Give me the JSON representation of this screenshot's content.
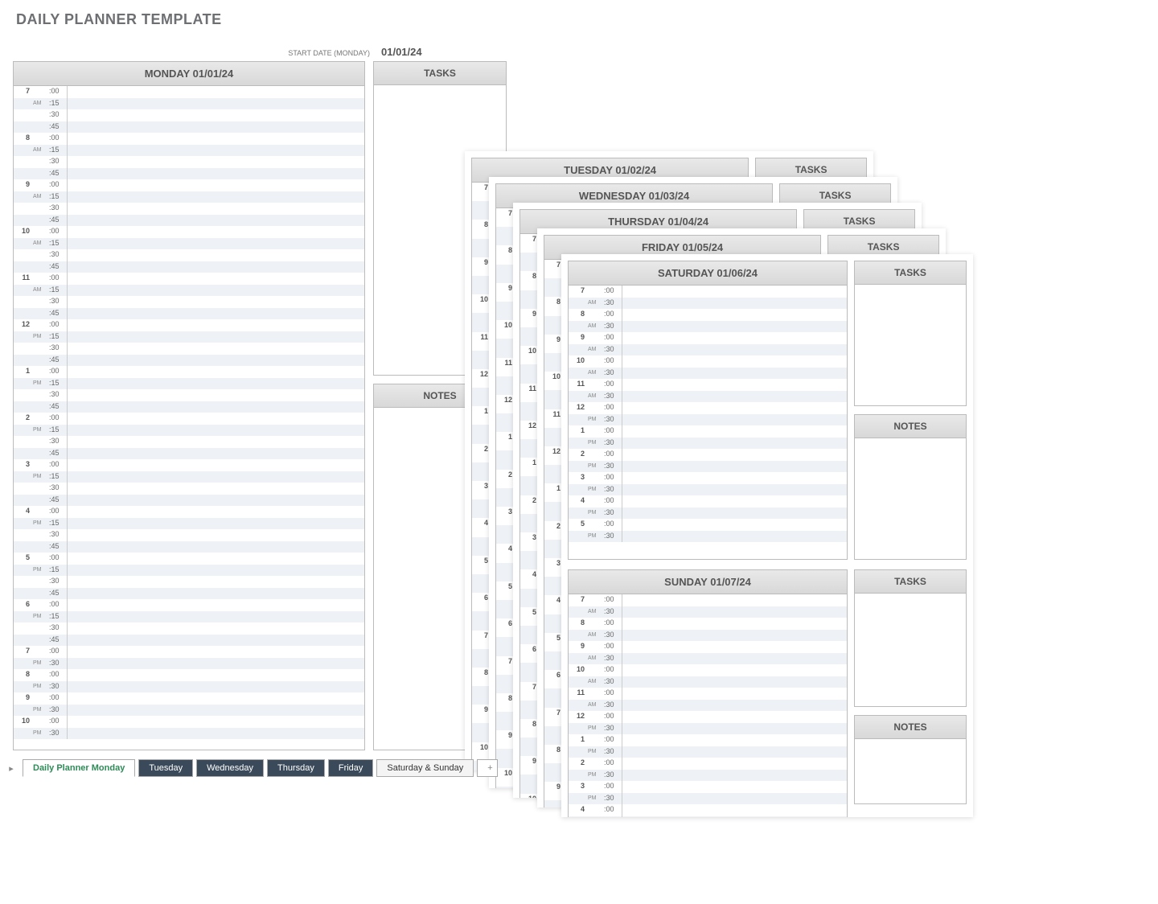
{
  "title": "DAILY PLANNER TEMPLATE",
  "start_date_label": "START DATE (MONDAY)",
  "start_date_value": "01/01/24",
  "tasks_label": "TASKS",
  "notes_label": "NOTES",
  "days": {
    "monday": "MONDAY 01/01/24",
    "tuesday": "TUESDAY 01/02/24",
    "wednesday": "WEDNESDAY 01/03/24",
    "thursday": "THURSDAY 01/04/24",
    "friday": "FRIDAY 01/05/24",
    "saturday": "SATURDAY 01/06/24",
    "sunday": "SUNDAY 01/07/24"
  },
  "monday_schedule": [
    {
      "hr": "7",
      "ap": "AM",
      "mins": [
        ":00",
        ":15",
        ":30",
        ":45"
      ]
    },
    {
      "hr": "8",
      "ap": "AM",
      "mins": [
        ":00",
        ":15",
        ":30",
        ":45"
      ]
    },
    {
      "hr": "9",
      "ap": "AM",
      "mins": [
        ":00",
        ":15",
        ":30",
        ":45"
      ]
    },
    {
      "hr": "10",
      "ap": "AM",
      "mins": [
        ":00",
        ":15",
        ":30",
        ":45"
      ]
    },
    {
      "hr": "11",
      "ap": "AM",
      "mins": [
        ":00",
        ":15",
        ":30",
        ":45"
      ]
    },
    {
      "hr": "12",
      "ap": "PM",
      "mins": [
        ":00",
        ":15",
        ":30",
        ":45"
      ]
    },
    {
      "hr": "1",
      "ap": "PM",
      "mins": [
        ":00",
        ":15",
        ":30",
        ":45"
      ]
    },
    {
      "hr": "2",
      "ap": "PM",
      "mins": [
        ":00",
        ":15",
        ":30",
        ":45"
      ]
    },
    {
      "hr": "3",
      "ap": "PM",
      "mins": [
        ":00",
        ":15",
        ":30",
        ":45"
      ]
    },
    {
      "hr": "4",
      "ap": "PM",
      "mins": [
        ":00",
        ":15",
        ":30",
        ":45"
      ]
    },
    {
      "hr": "5",
      "ap": "PM",
      "mins": [
        ":00",
        ":15",
        ":30",
        ":45"
      ]
    },
    {
      "hr": "6",
      "ap": "PM",
      "mins": [
        ":00",
        ":15",
        ":30",
        ":45"
      ]
    },
    {
      "hr": "7",
      "ap": "PM",
      "mins": [
        ":00",
        ":30"
      ]
    },
    {
      "hr": "8",
      "ap": "PM",
      "mins": [
        ":00",
        ":30"
      ]
    },
    {
      "hr": "9",
      "ap": "PM",
      "mins": [
        ":00",
        ":30"
      ]
    },
    {
      "hr": "10",
      "ap": "PM",
      "mins": [
        ":00",
        ":30"
      ]
    }
  ],
  "half_hour_schedule": [
    {
      "hr": "7",
      "ap": "AM",
      "mins": [
        ":00",
        ":30"
      ]
    },
    {
      "hr": "8",
      "ap": "AM",
      "mins": [
        ":00",
        ":30"
      ]
    },
    {
      "hr": "9",
      "ap": "AM",
      "mins": [
        ":00",
        ":30"
      ]
    },
    {
      "hr": "10",
      "ap": "AM",
      "mins": [
        ":00",
        ":30"
      ]
    },
    {
      "hr": "11",
      "ap": "AM",
      "mins": [
        ":00",
        ":30"
      ]
    },
    {
      "hr": "12",
      "ap": "PM",
      "mins": [
        ":00",
        ":30"
      ]
    },
    {
      "hr": "1",
      "ap": "PM",
      "mins": [
        ":00",
        ":30"
      ]
    },
    {
      "hr": "2",
      "ap": "PM",
      "mins": [
        ":00",
        ":30"
      ]
    },
    {
      "hr": "3",
      "ap": "PM",
      "mins": [
        ":00",
        ":30"
      ]
    },
    {
      "hr": "4",
      "ap": "PM",
      "mins": [
        ":00",
        ":30"
      ]
    },
    {
      "hr": "5",
      "ap": "PM",
      "mins": [
        ":00",
        ":30"
      ]
    },
    {
      "hr": "6",
      "ap": "PM",
      "mins": [
        ":00",
        ":30"
      ]
    },
    {
      "hr": "7",
      "ap": "PM",
      "mins": [
        ":00",
        ":30"
      ]
    },
    {
      "hr": "8",
      "ap": "PM",
      "mins": [
        ":00",
        ":30"
      ]
    },
    {
      "hr": "9",
      "ap": "PM",
      "mins": [
        ":00",
        ":30"
      ]
    },
    {
      "hr": "10",
      "ap": "PM",
      "mins": [
        ":00",
        ":30"
      ]
    }
  ],
  "weekend_hours": [
    {
      "hr": "7",
      "ap": "AM"
    },
    {
      "hr": "8",
      "ap": "AM"
    },
    {
      "hr": "9",
      "ap": "AM"
    },
    {
      "hr": "10",
      "ap": "AM"
    },
    {
      "hr": "11",
      "ap": "AM"
    },
    {
      "hr": "12",
      "ap": "PM"
    },
    {
      "hr": "1",
      "ap": "PM"
    },
    {
      "hr": "2",
      "ap": "PM"
    },
    {
      "hr": "3",
      "ap": "PM"
    },
    {
      "hr": "4",
      "ap": "PM"
    },
    {
      "hr": "5",
      "ap": "PM"
    }
  ],
  "tabs": [
    {
      "label": "Daily Planner Monday",
      "active": true,
      "dark": false
    },
    {
      "label": "Tuesday",
      "active": false,
      "dark": true
    },
    {
      "label": "Wednesday",
      "active": false,
      "dark": true
    },
    {
      "label": "Thursday",
      "active": false,
      "dark": true
    },
    {
      "label": "Friday",
      "active": false,
      "dark": true
    },
    {
      "label": "Saturday & Sunday",
      "active": false,
      "dark": false
    }
  ]
}
